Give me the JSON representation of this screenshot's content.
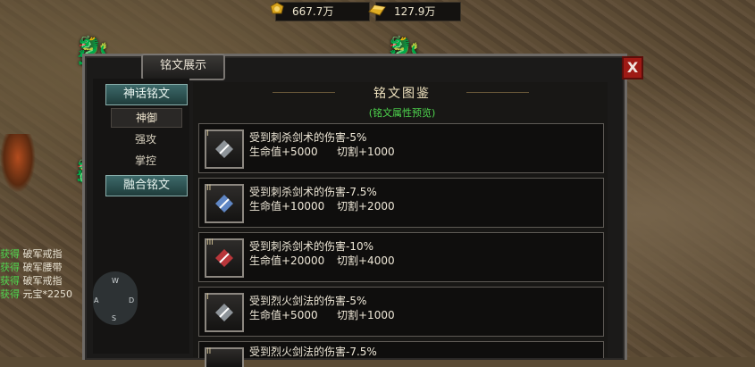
{
  "currency": {
    "gold": "667.7万",
    "ingot": "127.9万"
  },
  "window": {
    "title": "铭文展示",
    "close_label": "X"
  },
  "sidebar": {
    "group1": "神话铭文",
    "items": [
      "神御",
      "强攻",
      "掌控"
    ],
    "group2": "融合铭文"
  },
  "main": {
    "title": "铭文图鉴",
    "subtitle": "(铭文属性预览)"
  },
  "cards": [
    {
      "tier": "I",
      "gem_color": "#8e9499",
      "line1": "受到刺杀剑术的伤害-5%",
      "hp": "生命值+5000",
      "cut": "切割+1000"
    },
    {
      "tier": "II",
      "gem_color": "#5f86c4",
      "line1": "受到刺杀剑术的伤害-7.5%",
      "hp": "生命值+10000",
      "cut": "切割+2000"
    },
    {
      "tier": "III",
      "gem_color": "#b8363a",
      "line1": "受到刺杀剑术的伤害-10%",
      "hp": "生命值+20000",
      "cut": "切割+4000"
    },
    {
      "tier": "I",
      "gem_color": "#8e9499",
      "line1": "受到烈火剑法的伤害-5%",
      "hp": "生命值+5000",
      "cut": "切割+1000"
    },
    {
      "tier": "II",
      "gem_color": "#5f86c4",
      "line1": "受到烈火剑法的伤害-7.5%",
      "hp": "",
      "cut": ""
    }
  ],
  "log": [
    {
      "tag": "获得",
      "text": "破军戒指"
    },
    {
      "tag": "获得",
      "text": "破军腰带"
    },
    {
      "tag": "获得",
      "text": "破军戒指"
    },
    {
      "tag": "获得",
      "text": "元宝*2250"
    }
  ],
  "joystick": {
    "w": "W",
    "a": "A",
    "s": "S",
    "d": "D"
  }
}
